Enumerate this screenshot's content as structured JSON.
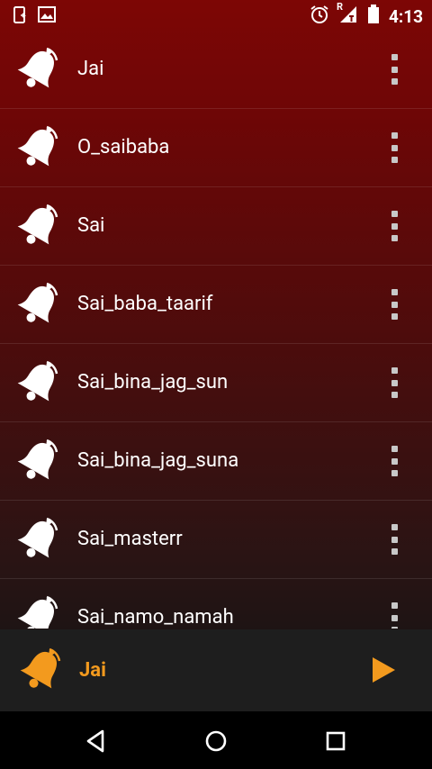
{
  "status_bar": {
    "left_icons": [
      "phone-sync-icon",
      "image-icon"
    ],
    "right_icons": [
      "alarm-icon",
      "signal-roaming-icon",
      "battery-icon"
    ],
    "roaming_label": "R",
    "time": "4:13"
  },
  "songs": [
    {
      "title": "Jai"
    },
    {
      "title": "O_saibaba"
    },
    {
      "title": "Sai"
    },
    {
      "title": "Sai_baba_taarif"
    },
    {
      "title": "Sai_bina_jag_sun"
    },
    {
      "title": "Sai_bina_jag_suna"
    },
    {
      "title": "Sai_masterr"
    },
    {
      "title": "Sai_namo_namah"
    }
  ],
  "now_playing": {
    "title": "Jai",
    "accent_color": "#f39a1e"
  },
  "navbar": {
    "buttons": [
      "back-icon",
      "home-icon",
      "recents-icon"
    ]
  },
  "colors": {
    "background_top": "#7d0605",
    "background_bottom": "#1e1414",
    "icon_white": "#ffffff"
  }
}
